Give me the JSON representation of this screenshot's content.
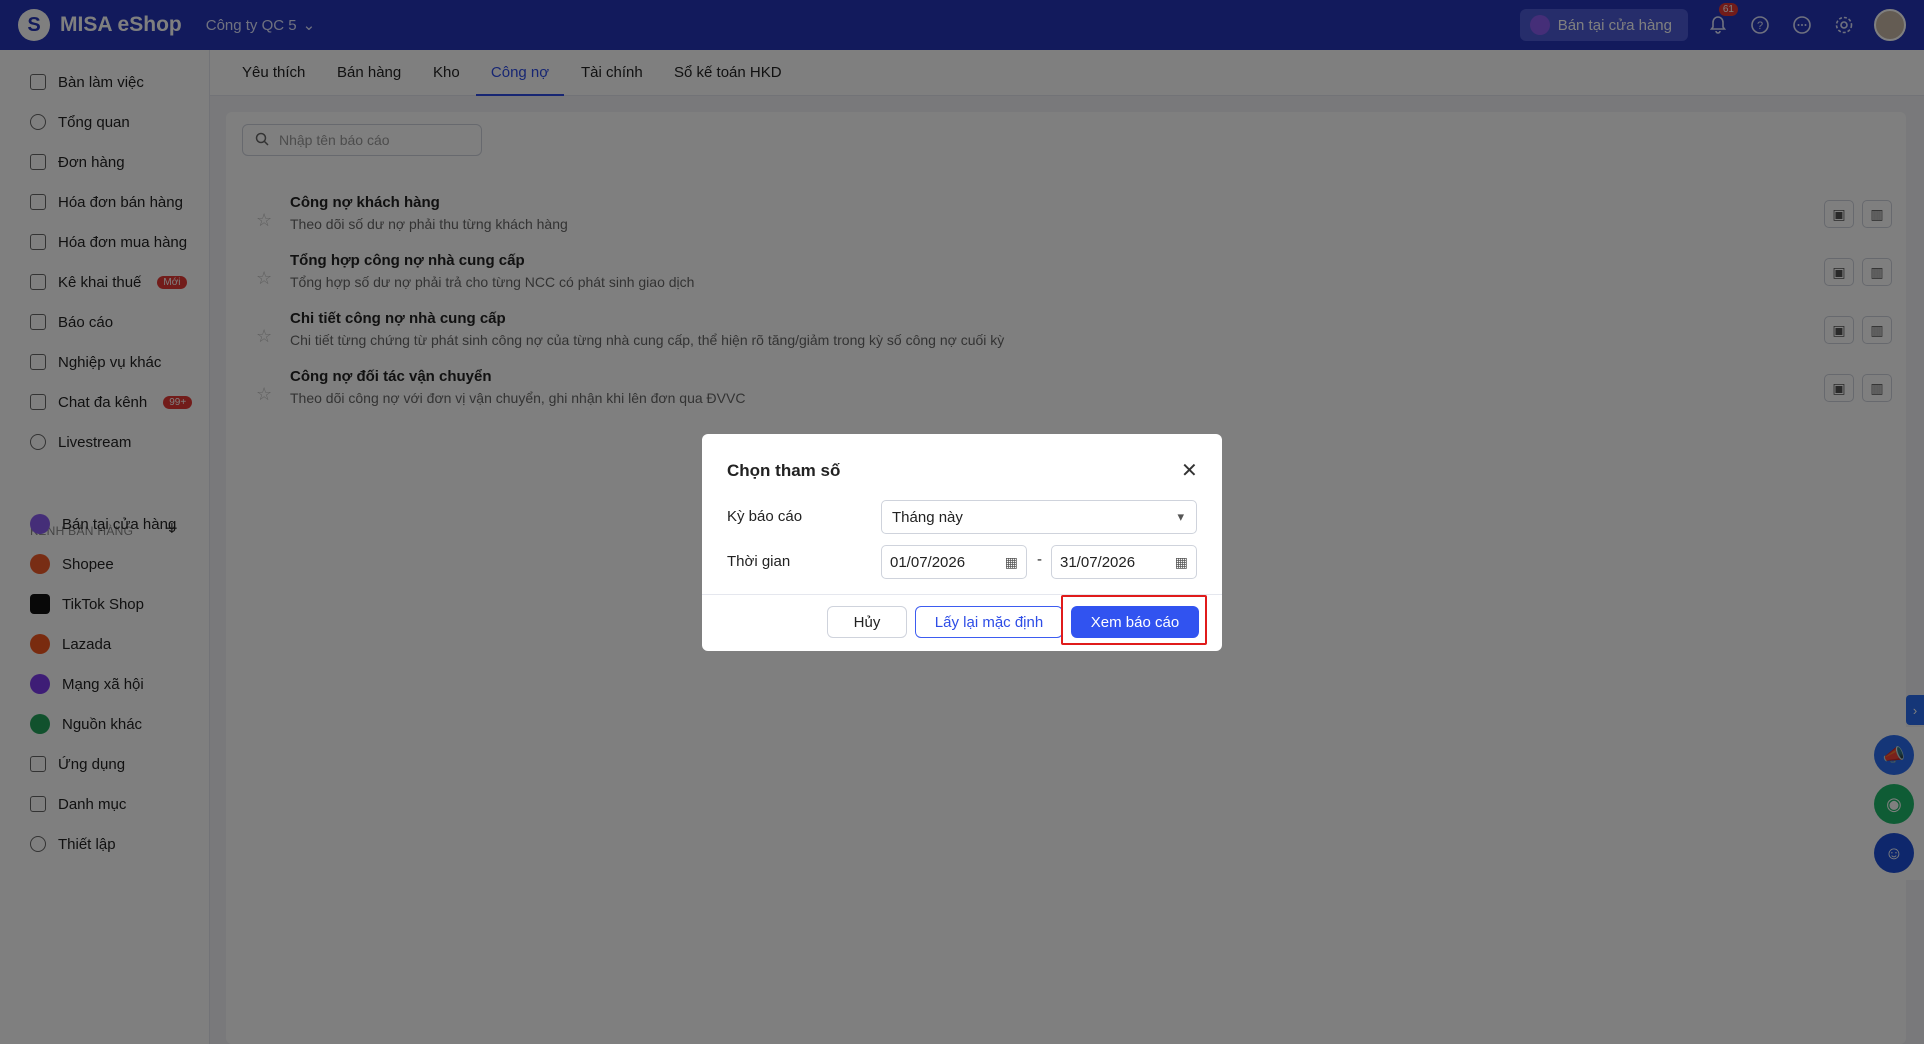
{
  "topbar": {
    "logo_glyph": "S",
    "app_name": "MISA eShop",
    "company": "Công ty QC 5",
    "store_button": "Bán tại cửa hàng",
    "notification_count": "61"
  },
  "sidebar": {
    "items": [
      {
        "label": "Bàn làm việc",
        "icon": "flag-icon"
      },
      {
        "label": "Tổng quan",
        "icon": "dashboard-icon"
      },
      {
        "label": "Đơn hàng",
        "icon": "order-icon"
      },
      {
        "label": "Hóa đơn bán hàng",
        "icon": "invoice-icon"
      },
      {
        "label": "Hóa đơn mua hàng",
        "icon": "invoice-icon"
      },
      {
        "label": "Kê khai thuế",
        "icon": "tax-icon",
        "badge": "Mới"
      },
      {
        "label": "Báo cáo",
        "icon": "chart-icon"
      },
      {
        "label": "Nghiệp vụ khác",
        "icon": "list-icon"
      },
      {
        "label": "Chat đa kênh",
        "icon": "chat-icon",
        "badge": "99+"
      },
      {
        "label": "Livestream",
        "icon": "broadcast-icon"
      }
    ],
    "section_title": "KÊNH BÁN HÀNG",
    "section_add": "+",
    "channels": [
      {
        "label": "Bán tại cửa hàng",
        "color": "#8a5cf0"
      },
      {
        "label": "Shopee",
        "color": "#f05a28"
      },
      {
        "label": "TikTok Shop",
        "color": "#111111"
      },
      {
        "label": "Lazada",
        "color": "#f2571f"
      },
      {
        "label": "Mạng xã hội",
        "color": "#7c3aed"
      },
      {
        "label": "Nguồn khác",
        "color": "#22a35a"
      }
    ],
    "bottom_items": [
      {
        "label": "Ứng dụng",
        "icon": "apps-icon"
      },
      {
        "label": "Danh mục",
        "icon": "list-icon"
      },
      {
        "label": "Thiết lập",
        "icon": "gear-icon"
      }
    ]
  },
  "tabs": [
    "Yêu thích",
    "Bán hàng",
    "Kho",
    "Công nợ",
    "Tài chính",
    "Sổ kế toán HKD"
  ],
  "active_tab": "Công nợ",
  "search": {
    "placeholder": "Nhập tên báo cáo"
  },
  "reports": [
    {
      "title": "Công nợ khách hàng",
      "desc": "Theo dõi số dư nợ phải thu từng khách hàng"
    },
    {
      "title": "Tổng hợp công nợ nhà cung cấp",
      "desc": "Tổng hợp số dư nợ phải trả cho từng NCC có phát sinh giao dịch"
    },
    {
      "title": "Chi tiết công nợ nhà cung cấp",
      "desc": "Chi tiết từng chứng từ phát sinh công nợ của từng nhà cung cấp, thể hiện rõ tăng/giảm trong kỳ số công nợ cuối kỳ"
    },
    {
      "title": "Công nợ đối tác vận chuyển",
      "desc": "Theo dõi công nợ với đơn vị vận chuyển, ghi nhận khi lên đơn qua ĐVVC"
    }
  ],
  "dialog": {
    "title": "Chọn tham số",
    "period_label": "Kỳ báo cáo",
    "period_value": "Tháng này",
    "time_label": "Thời gian",
    "date_from": "01/07/2026",
    "date_sep": "-",
    "date_to": "31/07/2026",
    "cancel": "Hủy",
    "reset": "Lấy lại mặc định",
    "view": "Xem báo cáo"
  },
  "colors": {
    "brand": "#2535b8",
    "accent": "#3153f0",
    "highlight": "#e01b1b"
  }
}
